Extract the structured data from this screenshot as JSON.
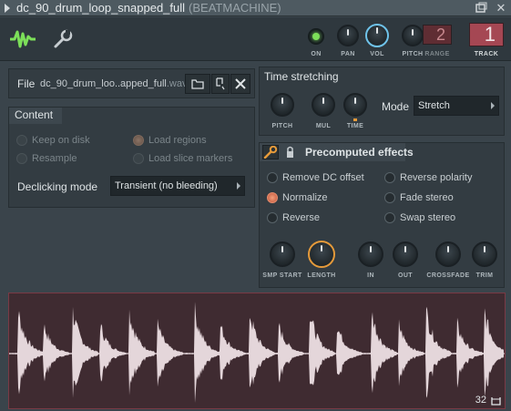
{
  "window": {
    "title": "dc_90_drum_loop_snapped_full",
    "app": "(BEATMACHINE)",
    "close_glyph": "✕"
  },
  "header": {
    "knobs": [
      {
        "label": "ON",
        "icon": "power-led"
      },
      {
        "label": "PAN"
      },
      {
        "label": "VOL"
      },
      {
        "label": "PITCH"
      }
    ],
    "range_value": "2",
    "range_label": "RANGE",
    "track_value": "1",
    "track_label": "TRACK"
  },
  "file": {
    "label": "File",
    "name": "dc_90_drum_loo..apped_full",
    "ext": ".wav"
  },
  "content": {
    "title": "Content",
    "options": [
      {
        "label": "Keep on disk",
        "state": "disabled"
      },
      {
        "label": "Load regions",
        "state": "disabled-on"
      },
      {
        "label": "Resample",
        "state": "disabled"
      },
      {
        "label": "Load slice markers",
        "state": "disabled"
      }
    ],
    "declicking_label": "Declicking mode",
    "declicking_value": "Transient (no bleeding)"
  },
  "time_stretching": {
    "title": "Time stretching",
    "knobs": [
      "PITCH",
      "MUL",
      "TIME"
    ],
    "mode_label": "Mode",
    "mode_value": "Stretch"
  },
  "precomputed": {
    "title": "Precomputed effects",
    "options": [
      {
        "label": "Remove DC offset",
        "on": false
      },
      {
        "label": "Reverse polarity",
        "on": false
      },
      {
        "label": "Normalize",
        "on": true
      },
      {
        "label": "Fade stereo",
        "on": false
      },
      {
        "label": "Reverse",
        "on": false
      },
      {
        "label": "Swap stereo",
        "on": false
      }
    ],
    "knobs": [
      "SMP START",
      "LENGTH",
      "IN",
      "OUT",
      "CROSSFADE",
      "TRIM"
    ]
  },
  "waveform": {
    "counter": "32"
  },
  "colors": {
    "accent_orange": "#e59a3a",
    "accent_blue": "#6fc3ea",
    "led_green": "#7cdf59",
    "waveform_bg": "#3f2b31",
    "waveform_fill": "#e4d6da"
  }
}
